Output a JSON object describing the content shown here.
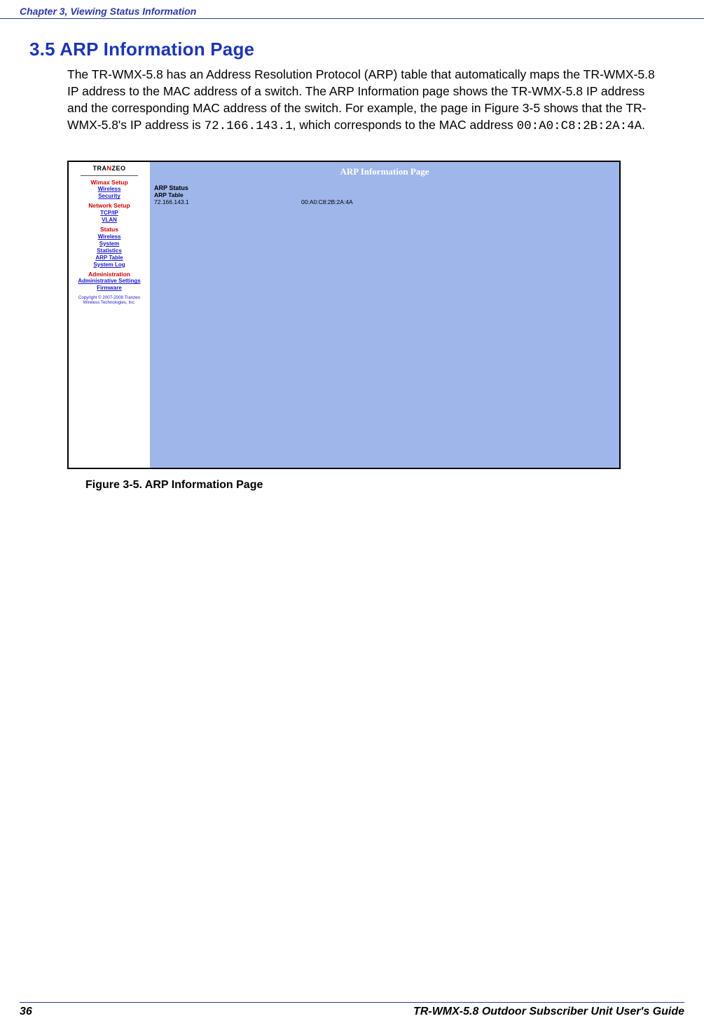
{
  "header": {
    "chapter": "Chapter 3, Viewing Status Information"
  },
  "section": {
    "heading": "3.5 ARP Information Page"
  },
  "paragraph": {
    "p1a": "The TR-WMX-5.8 has an Address Resolution Protocol (ARP) table that automatically maps the TR-WMX-5.8 IP address to the MAC address of a switch. The ARP Information page shows the TR-WMX-5.8 IP address and the corresponding MAC address of the switch. For example, the page in Figure 3-5 shows that the TR-WMX-5.8's IP address is ",
    "ip": "72.166.143.1",
    "p1b": ", which corresponds to the MAC address ",
    "mac": "00:A0:C8:2B:2A:4A",
    "p1c": "."
  },
  "screenshot": {
    "logo_tra": "TRA",
    "logo_in": "N",
    "logo_zeo": "ZEO",
    "nav": {
      "wimax": "Wimax Setup",
      "wireless1": "Wireless",
      "security": "Security",
      "network": "Network Setup",
      "tcpip": "TCP/IP",
      "vlan": "VLAN",
      "status": "Status",
      "wireless2": "Wireless",
      "system": "System",
      "statistics": "Statistics",
      "arp": "ARP Table",
      "syslog": "System Log",
      "admin": "Administration",
      "admin_settings": "Administrative Settings",
      "firmware": "Firmware"
    },
    "copyright": "Copyright © 2007-2008 Tranzeo Wireless Technologies, Inc.",
    "title": "ARP Information Page",
    "arp_status": "ARP Status",
    "arp_table": "ARP Table",
    "row": {
      "ip": "72.166.143.1",
      "mac": "00:A0:C8:2B:2A:4A"
    }
  },
  "figure": {
    "caption": "Figure 3-5. ARP Information Page"
  },
  "footer": {
    "page_number": "36",
    "title": "TR-WMX-5.8 Outdoor Subscriber Unit User's Guide"
  }
}
